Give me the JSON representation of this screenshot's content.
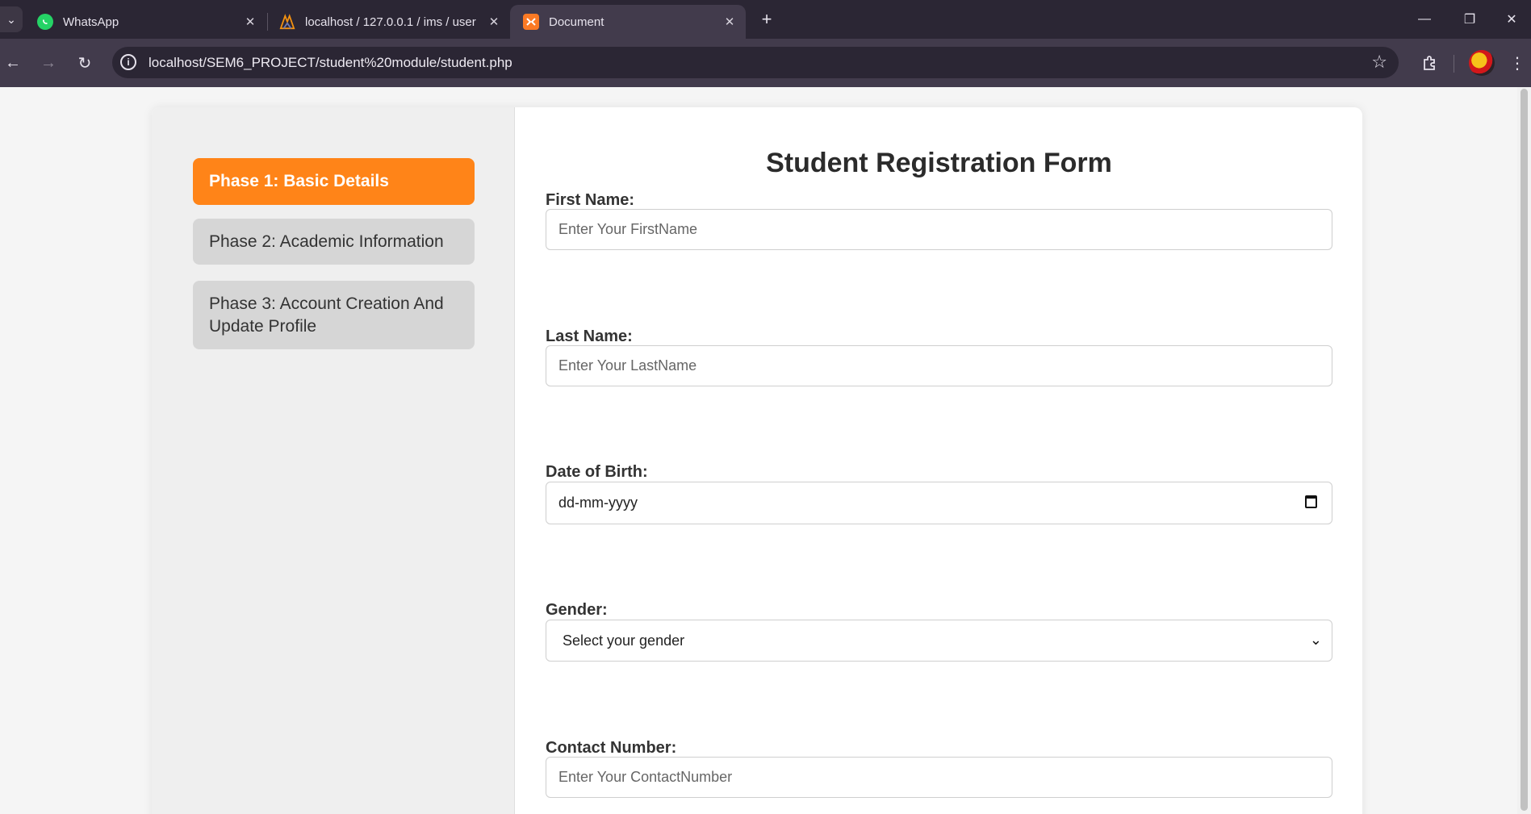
{
  "browser": {
    "tabs": [
      {
        "title": "WhatsApp",
        "icon": "whatsapp-icon"
      },
      {
        "title": "localhost / 127.0.0.1 / ims / user",
        "icon": "phpmyadmin-icon"
      },
      {
        "title": "Document",
        "icon": "xampp-icon",
        "active": true
      }
    ],
    "url": "localhost/SEM6_PROJECT/student%20module/student.php",
    "colors": {
      "tabbar": "#2b2634",
      "toolbar": "#423b4c"
    }
  },
  "sidebar": {
    "phases": [
      {
        "label": "Phase 1: Basic Details",
        "active": true
      },
      {
        "label": "Phase 2: Academic Information",
        "active": false
      },
      {
        "label": "Phase 3: Account Creation And Update Profile",
        "active": false
      }
    ],
    "active_color": "#ff8418"
  },
  "form": {
    "title": "Student Registration Form",
    "fields": {
      "first_name": {
        "label": "First Name:",
        "placeholder": "Enter Your FirstName"
      },
      "last_name": {
        "label": "Last Name:",
        "placeholder": "Enter Your LastName"
      },
      "dob": {
        "label": "Date of Birth:",
        "value": "dd-mm-yyyy"
      },
      "gender": {
        "label": "Gender:",
        "selected": "Select your gender"
      },
      "contact": {
        "label": "Contact Number:",
        "placeholder": "Enter Your ContactNumber"
      }
    }
  }
}
